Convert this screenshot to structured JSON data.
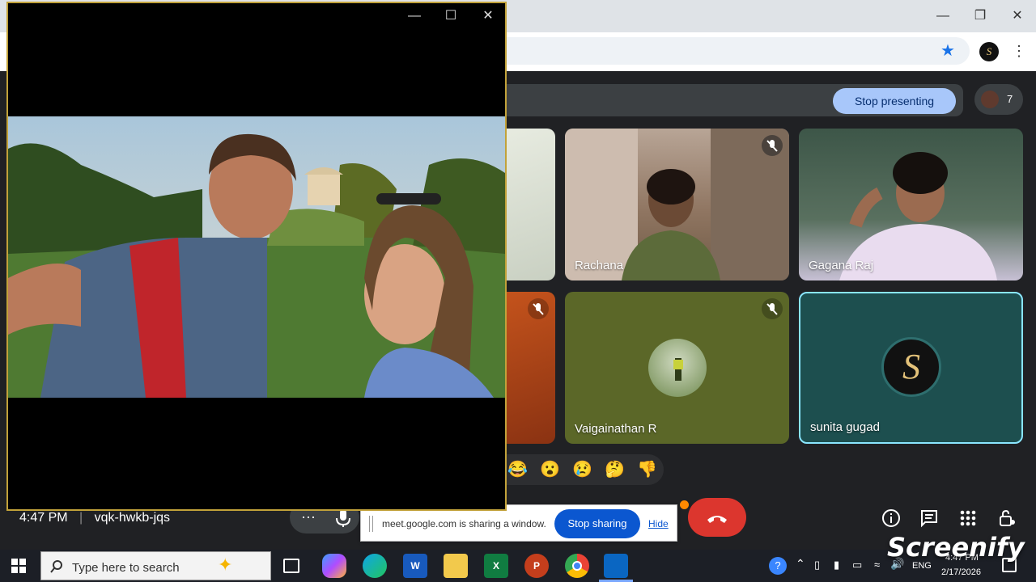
{
  "meet": {
    "stop_presenting_label": "Stop presenting",
    "participant_count": "7",
    "meeting_time": "4:47 PM",
    "meeting_code": "vqk-hwkb-jqs",
    "tiles": [
      {
        "name": "Rachana",
        "muted": true
      },
      {
        "name": "Gagana Raj",
        "muted": false
      },
      {
        "name": "Vaigainathan R",
        "muted": true
      },
      {
        "name": "sunita gugad",
        "muted": false
      }
    ],
    "reactions": [
      "😂",
      "😮",
      "😢",
      "🤔",
      "👎"
    ],
    "more_label": "⋯"
  },
  "share_notice": {
    "text": "meet.google.com is sharing a window.",
    "stop_sharing_label": "Stop sharing",
    "hide_label": "Hide"
  },
  "taskbar": {
    "search_placeholder": "Type here to search",
    "lang": "ENG",
    "clock_time": "4:47 PM",
    "clock_date": "2/17/2026"
  },
  "watermark": "Screenify",
  "colors": {
    "meet_bg": "#202124",
    "stop_presenting_bg": "#a8c7fa",
    "end_call": "#dc362e",
    "pip_border": "#c2a23a",
    "stop_sharing_bg": "#0b57d0",
    "active_tile_border": "#8ae6ff"
  }
}
